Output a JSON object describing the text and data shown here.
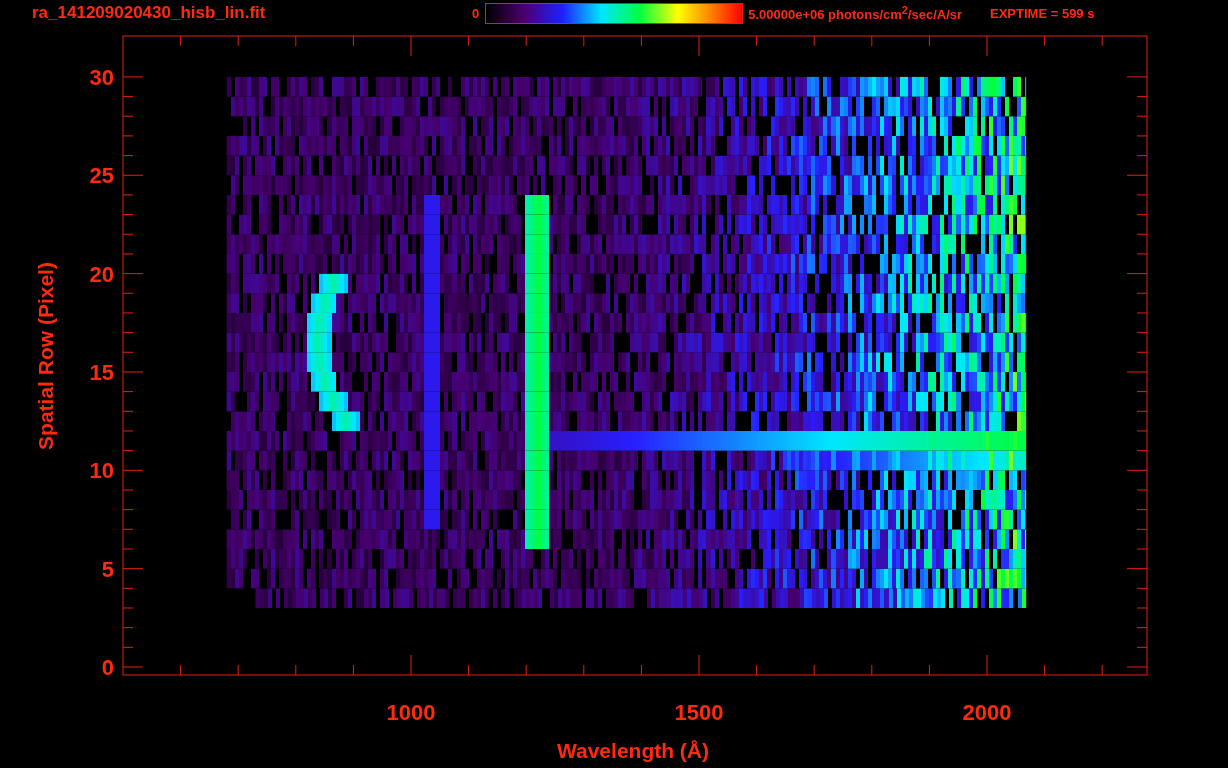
{
  "header": {
    "title": "ra_141209020430_hisb_lin.fit",
    "colorbar": {
      "min_label": "0",
      "max_label": "5.00000e+06 photons/cm$^{2}$/sec/A/sr"
    },
    "exposure": "EXPTIME = 599 s"
  },
  "plot": {
    "xlabel": "Wavelength (Å)",
    "ylabel": "Spatial Row (Pixel)",
    "xticks": [
      "1000",
      "1500",
      "2000"
    ],
    "yticks": [
      "30",
      "25",
      "20",
      "15",
      "10",
      "5",
      "0"
    ]
  }
}
